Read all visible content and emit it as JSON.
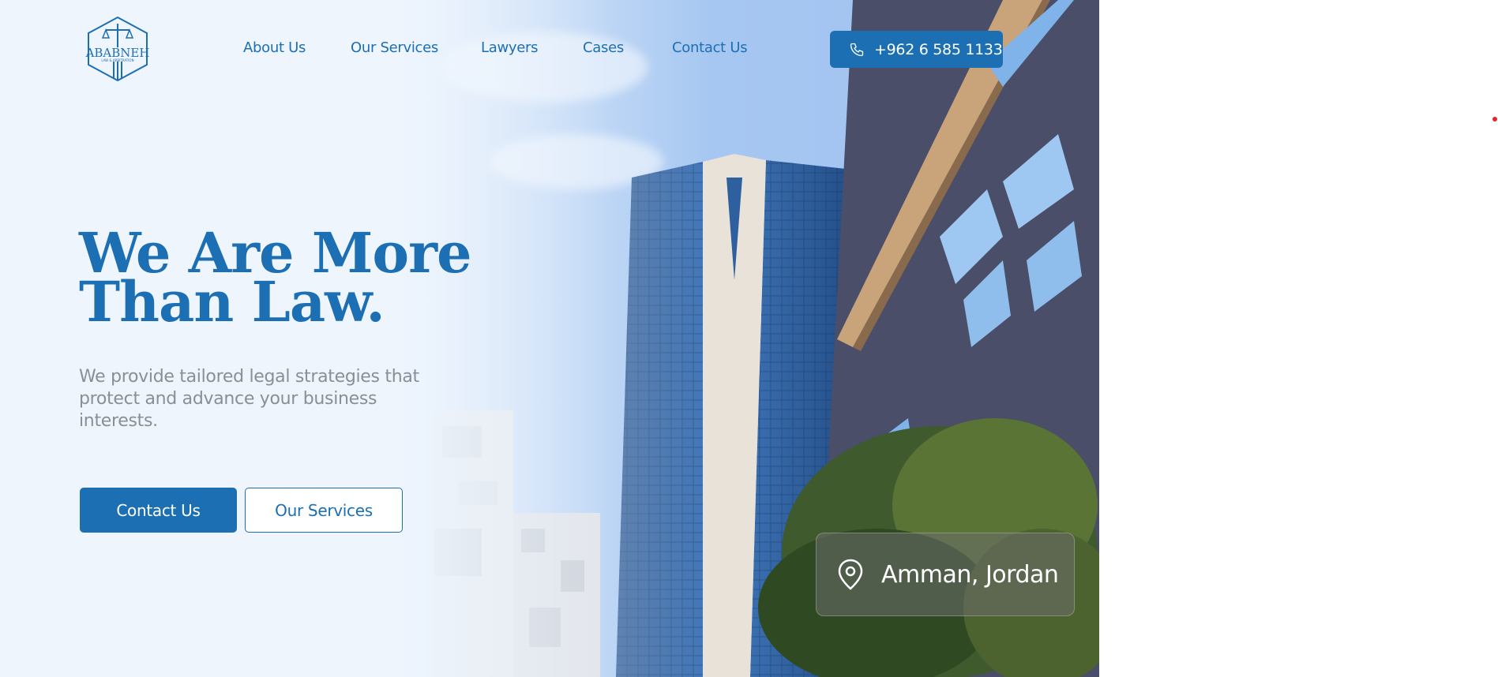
{
  "header": {
    "logo_text": "ABABNEH",
    "logo_tagline": "LAW & ARBITRATION",
    "nav": [
      {
        "label": "About Us"
      },
      {
        "label": "Our Services"
      },
      {
        "label": "Lawyers"
      },
      {
        "label": "Cases"
      },
      {
        "label": "Contact Us"
      }
    ],
    "phone": "+962 6 585 1133"
  },
  "hero": {
    "title_line1": "We Are More",
    "title_line2": "Than Law.",
    "subtitle": "We provide tailored legal strategies that protect and advance your business interests.",
    "primary_cta": "Contact Us",
    "secondary_cta": "Our Services"
  },
  "location": {
    "label": "Amman, Jordan",
    "icon": "map-pin-icon"
  },
  "colors": {
    "brand_blue": "#1d6fb4",
    "subtitle_gray": "#8a8f96",
    "accent_red": "#e0262b"
  }
}
